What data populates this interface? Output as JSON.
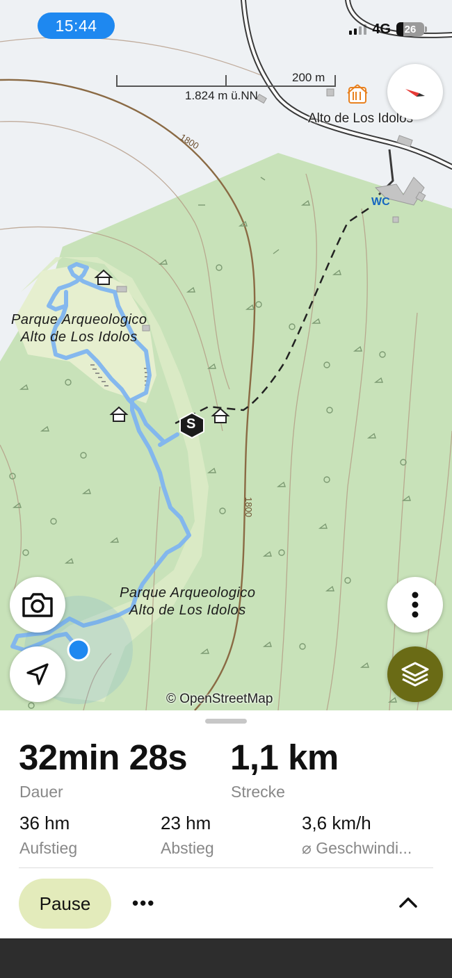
{
  "status_bar": {
    "time": "15:44",
    "network": "4G",
    "battery": "26"
  },
  "map": {
    "scale_distance": "200 m",
    "elevation": "1.824 m ü.NN",
    "contour_label": "1800",
    "contour_label_2": "1800",
    "poi_name": "Alto de Los Idolos",
    "wc_label": "WC",
    "start_marker": "S",
    "park_label_top_line1": "Parque Arqueologico",
    "park_label_top_line2": "Alto de Los Idolos",
    "park_label_bottom_line1": "Parque Arqueologico",
    "park_label_bottom_line2": "Alto de Los Idolos",
    "attribution": "© OpenStreetMap",
    "colors": {
      "forest": "#c8e2b9",
      "track": "#7fb4ef",
      "location": "#1e88f0",
      "layers_button": "#6a6b15"
    }
  },
  "stats": {
    "duration_value": "32min 28s",
    "duration_label": "Dauer",
    "distance_value": "1,1 km",
    "distance_label": "Strecke",
    "ascent_value": "36 hm",
    "ascent_label": "Aufstieg",
    "descent_value": "23 hm",
    "descent_label": "Abstieg",
    "speed_value": "3,6 km/h",
    "speed_label": "⌀ Geschwindi..."
  },
  "controls": {
    "pause_label": "Pause",
    "more_label": "•••"
  },
  "icons": [
    "compass-icon",
    "camera-icon",
    "navigation-arrow-icon",
    "more-vertical-icon",
    "layers-icon",
    "chevron-up-icon",
    "restaurant-icon",
    "shelter-icon"
  ]
}
